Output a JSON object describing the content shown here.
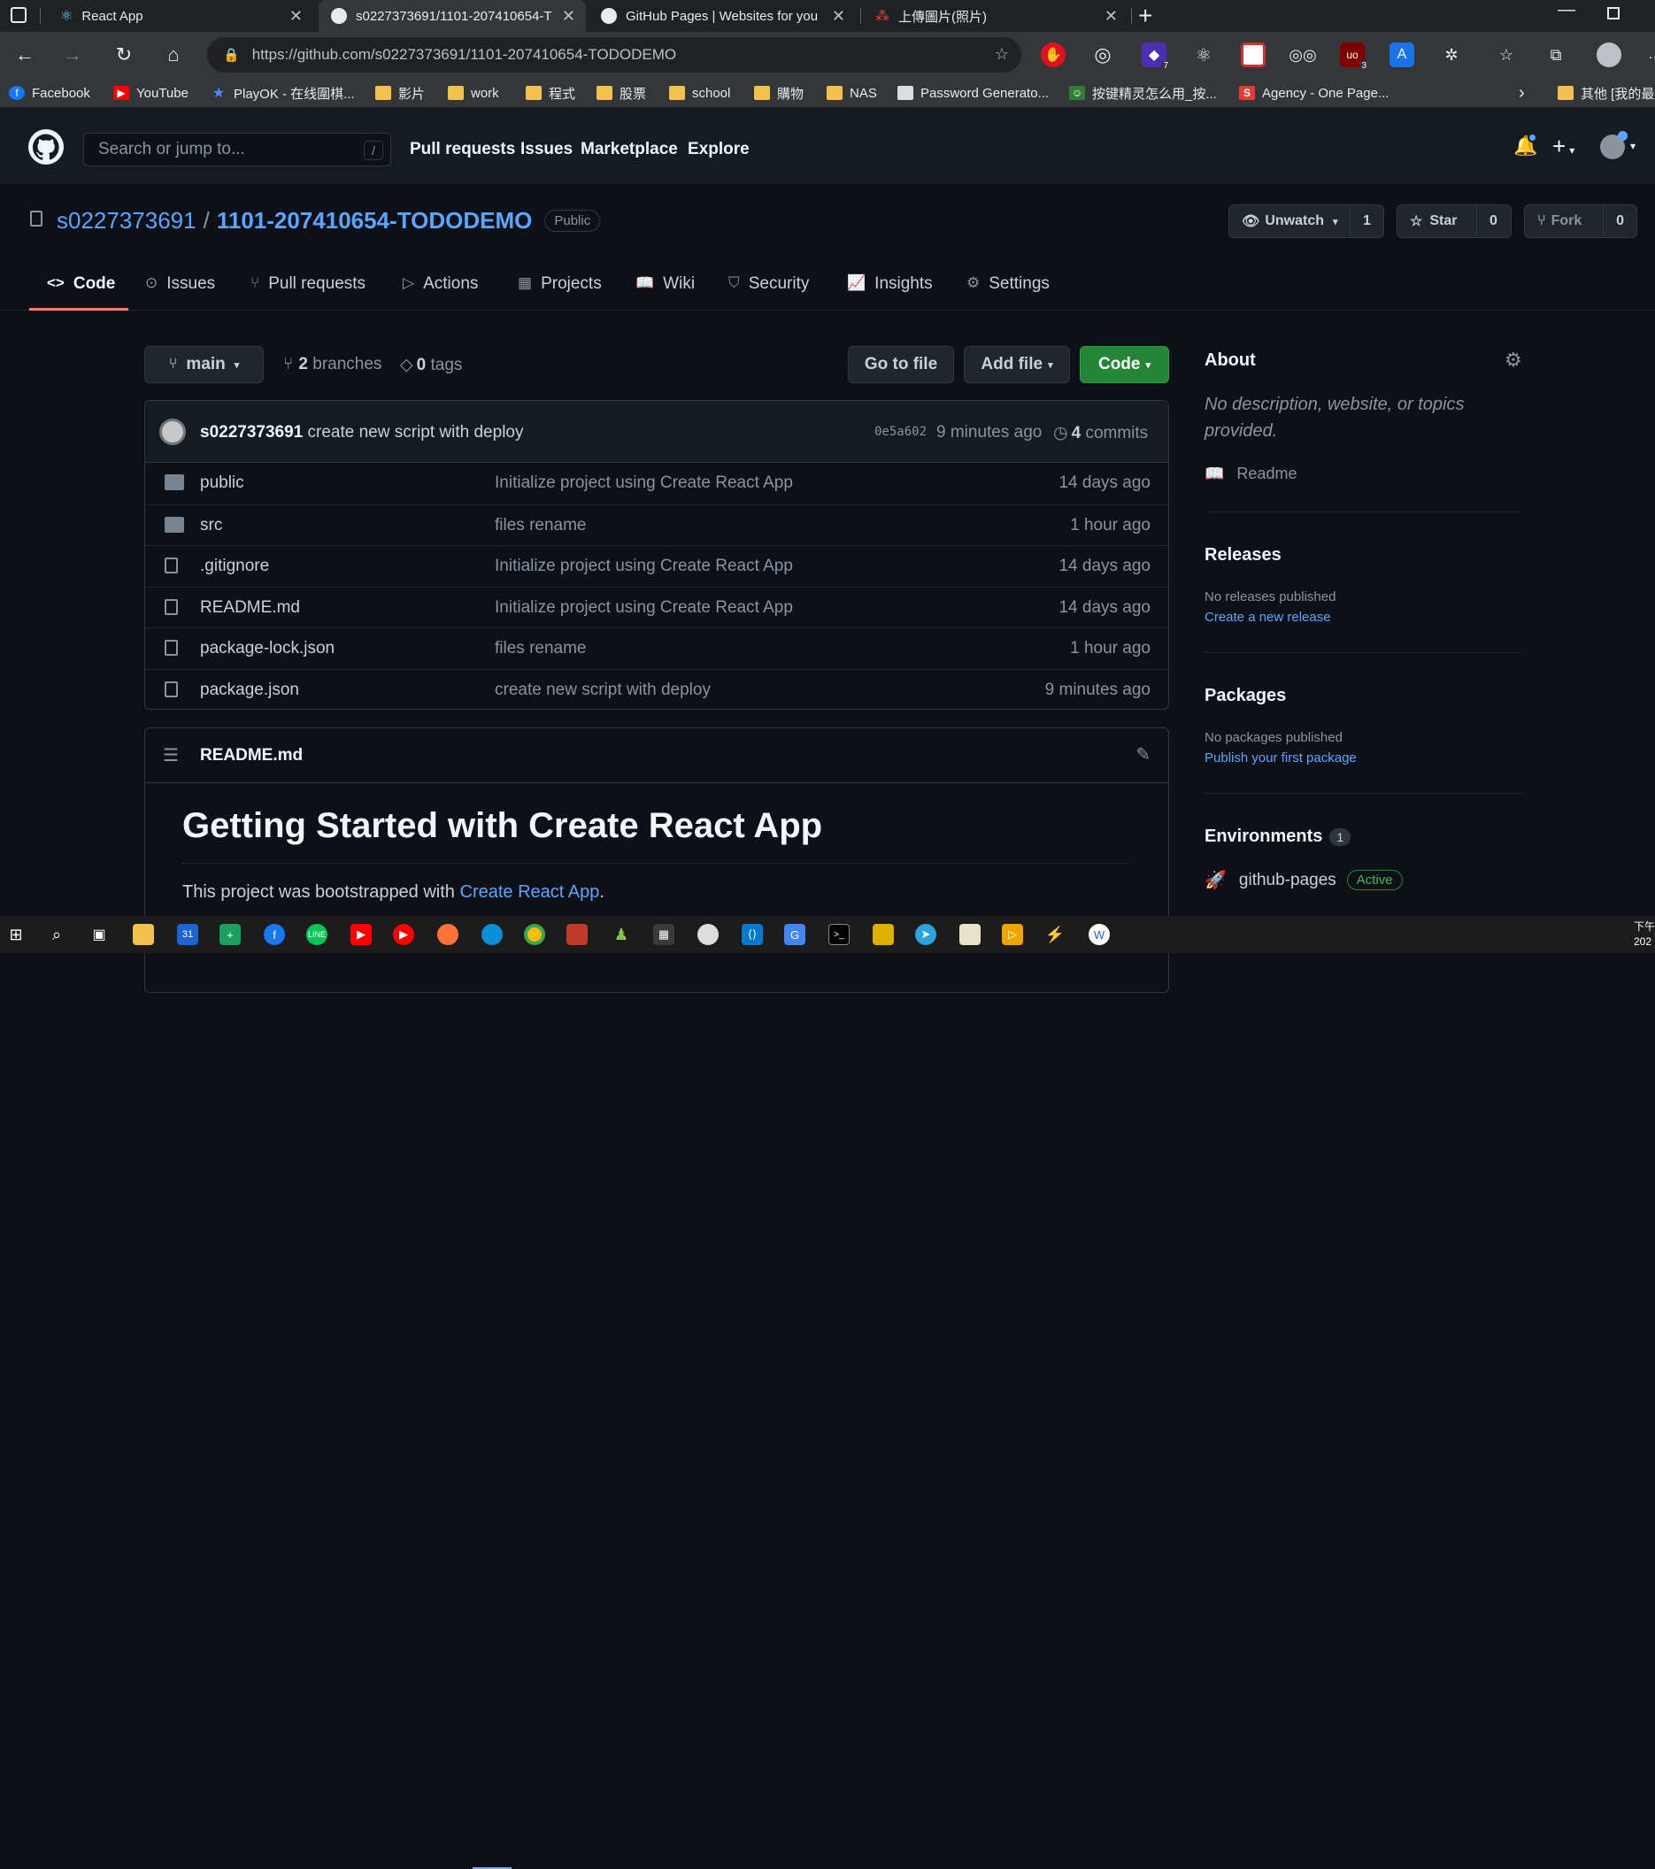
{
  "browser": {
    "tabs": [
      {
        "title": "React App",
        "active": false
      },
      {
        "title": "s0227373691/1101-207410654-T",
        "active": true
      },
      {
        "title": "GitHub Pages | Websites for you",
        "active": false
      },
      {
        "title": "上傳圖片(照片)",
        "active": false
      }
    ],
    "url": "https://github.com/s0227373691/1101-207410654-TODODEMO",
    "bookmarks": [
      "Facebook",
      "YouTube",
      "PlayOK - 在线圍棋...",
      "影片",
      "work",
      "程式",
      "股票",
      "school",
      "購物",
      "NAS",
      "Password Generato...",
      "按键精灵怎么用_按...",
      "Agency - One Page...",
      "其他 [我的最"
    ],
    "extension_badges": {
      "purple": "7",
      "ublock": "3"
    }
  },
  "github": {
    "search_placeholder": "Search or jump to...",
    "search_key": "/",
    "nav": [
      "Pull requests",
      "Issues",
      "Marketplace",
      "Explore"
    ]
  },
  "repo": {
    "owner": "s0227373691",
    "separator": "/",
    "name": "1101-207410654-TODODEMO",
    "visibility": "Public",
    "unwatch_label": "Unwatch",
    "watch_count": "1",
    "star_label": "Star",
    "star_count": "0",
    "fork_label": "Fork",
    "fork_count": "0",
    "tabs": [
      "Code",
      "Issues",
      "Pull requests",
      "Actions",
      "Projects",
      "Wiki",
      "Security",
      "Insights",
      "Settings"
    ]
  },
  "toolbar": {
    "branch": "main",
    "branches_count": "2",
    "branches_label": "branches",
    "tags_count": "0",
    "tags_label": "tags",
    "go_to_file": "Go to file",
    "add_file": "Add file",
    "code": "Code"
  },
  "commit": {
    "author": "s0227373691",
    "message": "create new script with deploy",
    "hash": "0e5a602",
    "time": "9 minutes ago",
    "commits_count": "4",
    "commits_label": "commits"
  },
  "files": [
    {
      "name": "public",
      "type": "dir",
      "message": "Initialize project using Create React App",
      "age": "14 days ago"
    },
    {
      "name": "src",
      "type": "dir",
      "message": "files rename",
      "age": "1 hour ago"
    },
    {
      "name": ".gitignore",
      "type": "file",
      "message": "Initialize project using Create React App",
      "age": "14 days ago"
    },
    {
      "name": "README.md",
      "type": "file",
      "message": "Initialize project using Create React App",
      "age": "14 days ago"
    },
    {
      "name": "package-lock.json",
      "type": "file",
      "message": "files rename",
      "age": "1 hour ago"
    },
    {
      "name": "package.json",
      "type": "file",
      "message": "create new script with deploy",
      "age": "9 minutes ago"
    }
  ],
  "readme": {
    "filename": "README.md",
    "heading": "Getting Started with Create React App",
    "intro": "This project was bootstrapped with",
    "intro_link": "Create React App",
    "intro_end": "."
  },
  "sidebar": {
    "about_title": "About",
    "about_text": "No description, website, or topics provided.",
    "readme_label": "Readme",
    "releases_title": "Releases",
    "releases_text": "No releases published",
    "releases_link": "Create a new release",
    "packages_title": "Packages",
    "packages_text": "No packages published",
    "packages_link": "Publish your first package",
    "environments_title": "Environments",
    "environments_count": "1",
    "environment_name": "github-pages",
    "environment_status": "Active"
  },
  "taskbar": {
    "clock_top": "下午",
    "clock_bottom": "202"
  },
  "colors": {
    "bg": "#0d1117",
    "header": "#161b22",
    "link": "#58a6ff",
    "code_button": "#238636",
    "selected_tab": "#f78166"
  }
}
